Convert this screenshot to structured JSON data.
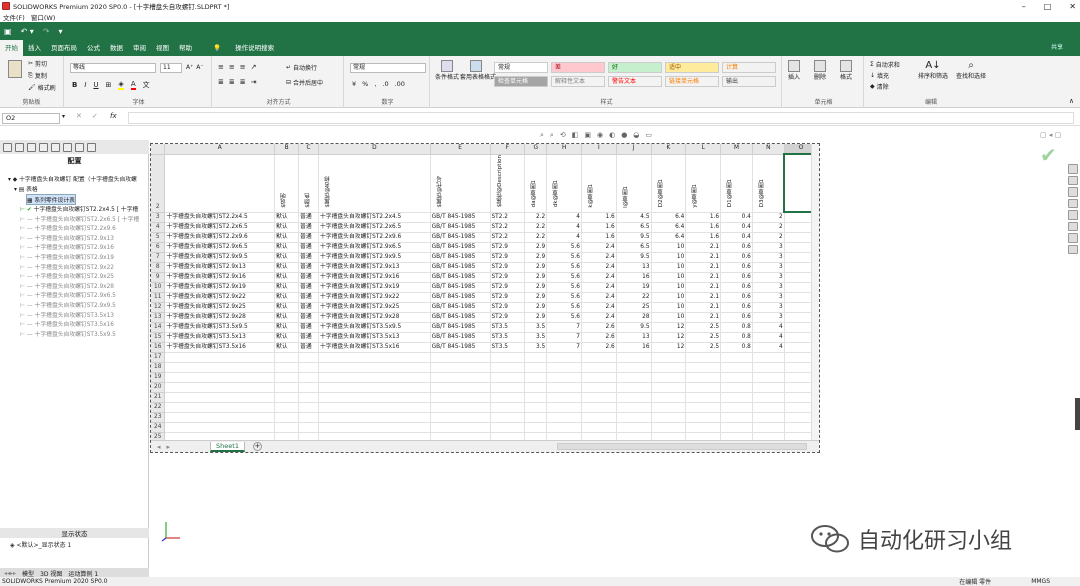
{
  "titlebar": {
    "title": "SOLIDWORKS Premium 2020 SP0.0 - [十字槽盘头自攻螺钉.SLDPRT *]"
  },
  "menubar": {
    "items": [
      "文件(F)",
      "窗口(W)"
    ]
  },
  "ribbon_tabs": {
    "tabs": [
      "开始",
      "插入",
      "页面布局",
      "公式",
      "数据",
      "审阅",
      "视图",
      "帮助"
    ],
    "search": "操作说明搜索",
    "share": "共享"
  },
  "ribbon": {
    "clipboard": {
      "cut": "剪切",
      "copy": "复制",
      "painter": "格式刷",
      "label": "剪贴板"
    },
    "font": {
      "name": "等线",
      "size": "11",
      "label": "字体"
    },
    "align": {
      "wrap": "自动换行",
      "merge": "合并后居中",
      "label": "对齐方式"
    },
    "number": {
      "format": "常规",
      "label": "数字"
    },
    "styles": {
      "cond": "条件格式",
      "table": "套用表格格式",
      "label": "样式",
      "cells": [
        {
          "t": "常规",
          "bg": "#ffffff",
          "fg": "#222"
        },
        {
          "t": "差",
          "bg": "#ffc7ce",
          "fg": "#9c0006"
        },
        {
          "t": "好",
          "bg": "#c6efce",
          "fg": "#006100"
        },
        {
          "t": "适中",
          "bg": "#ffeb9c",
          "fg": "#9c5700"
        },
        {
          "t": "计算",
          "bg": "#f2f2f2",
          "fg": "#fa7d00"
        },
        {
          "t": "检查单元格",
          "bg": "#a5a5a5",
          "fg": "#fff"
        },
        {
          "t": "解释性文本",
          "bg": "#f3f3f3",
          "fg": "#7f7f7f"
        },
        {
          "t": "警告文本",
          "bg": "#f3f3f3",
          "fg": "#ff0000"
        },
        {
          "t": "链接单元格",
          "bg": "#f3f3f3",
          "fg": "#fa7d00"
        },
        {
          "t": "输出",
          "bg": "#f2f2f2",
          "fg": "#3f3f3f"
        }
      ]
    },
    "cellsgrp": {
      "insert": "插入",
      "delete": "删除",
      "format": "格式",
      "label": "单元格"
    },
    "edit": {
      "autosum": "自动求和",
      "fill": "填充",
      "clear": "清除",
      "sort": "排序和筛选",
      "find": "查找和选择",
      "label": "编辑"
    }
  },
  "formula": {
    "namebox": "O2",
    "fx": "fx"
  },
  "leftpanel": {
    "title": "配置",
    "tree": [
      "十字槽盘头自攻螺钉 配置（十字槽盘头自攻螺",
      "表格",
      "系列零件设计表",
      "十字槽盘头自攻螺钉ST2.2x4.5 [ 十字槽",
      "十字槽盘头自攻螺钉ST2.2x6.5 [ 十字槽",
      "十字槽盘头自攻螺钉ST2.2x9.6",
      "十字槽盘头自攻螺钉ST2.9x13",
      "十字槽盘头自攻螺钉ST2.9x16",
      "十字槽盘头自攻螺钉ST2.9x19",
      "十字槽盘头自攻螺钉ST2.9x22",
      "十字槽盘头自攻螺钉ST2.9x25",
      "十字槽盘头自攻螺钉ST2.9x28",
      "十字槽盘头自攻螺钉ST2.9x6.5",
      "十字槽盘头自攻螺钉ST2.9x9.5",
      "十字槽盘头自攻螺钉ST3.5x13",
      "十字槽盘头自攻螺钉ST3.5x16",
      "十字槽盘头自攻螺钉ST3.5x9.5"
    ],
    "display_state_title": "显示状态",
    "display_state": "<默认>_显示状态 1",
    "bottom_tabs": [
      "模型",
      "3D 视图",
      "运动算例 1"
    ]
  },
  "sheet": {
    "cols": [
      "A",
      "B",
      "C",
      "D",
      "E",
      "F",
      "G",
      "H",
      "I",
      "J",
      "K",
      "L",
      "M",
      "N",
      "O"
    ],
    "headers": [
      "",
      "$说明",
      "$颜色",
      "$属性@名称",
      "$属性@代号",
      "$属性@Description",
      "da@草图1",
      "dk@草图1",
      "k@草图1",
      "l@草图1",
      "D2@草图1",
      "y@草图1",
      "D1@草图1",
      "D3@草图1",
      ""
    ],
    "rows": [
      [
        "十字槽盘头自攻螺钉ST2.2x4.5",
        "默认",
        "普通",
        "十字槽盘头自攻螺钉ST2.2x4.5",
        "GB/T 845-1985",
        "ST2.2",
        "2.2",
        "4",
        "1.6",
        "4.5",
        "6.4",
        "1.6",
        "0.4",
        "2"
      ],
      [
        "十字槽盘头自攻螺钉ST2.2x6.5",
        "默认",
        "普通",
        "十字槽盘头自攻螺钉ST2.2x6.5",
        "GB/T 845-1985",
        "ST2.2",
        "2.2",
        "4",
        "1.6",
        "6.5",
        "6.4",
        "1.6",
        "0.4",
        "2"
      ],
      [
        "十字槽盘头自攻螺钉ST2.2x9.6",
        "默认",
        "普通",
        "十字槽盘头自攻螺钉ST2.2x9.6",
        "GB/T 845-1985",
        "ST2.2",
        "2.2",
        "4",
        "1.6",
        "9.5",
        "6.4",
        "1.6",
        "0.4",
        "2"
      ],
      [
        "十字槽盘头自攻螺钉ST2.9x6.5",
        "默认",
        "普通",
        "十字槽盘头自攻螺钉ST2.9x6.5",
        "GB/T 845-1985",
        "ST2.9",
        "2.9",
        "5.6",
        "2.4",
        "6.5",
        "10",
        "2.1",
        "0.6",
        "3"
      ],
      [
        "十字槽盘头自攻螺钉ST2.9x9.5",
        "默认",
        "普通",
        "十字槽盘头自攻螺钉ST2.9x9.5",
        "GB/T 845-1985",
        "ST2.9",
        "2.9",
        "5.6",
        "2.4",
        "9.5",
        "10",
        "2.1",
        "0.6",
        "3"
      ],
      [
        "十字槽盘头自攻螺钉ST2.9x13",
        "默认",
        "普通",
        "十字槽盘头自攻螺钉ST2.9x13",
        "GB/T 845-1985",
        "ST2.9",
        "2.9",
        "5.6",
        "2.4",
        "13",
        "10",
        "2.1",
        "0.6",
        "3"
      ],
      [
        "十字槽盘头自攻螺钉ST2.9x16",
        "默认",
        "普通",
        "十字槽盘头自攻螺钉ST2.9x16",
        "GB/T 845-1985",
        "ST2.9",
        "2.9",
        "5.6",
        "2.4",
        "16",
        "10",
        "2.1",
        "0.6",
        "3"
      ],
      [
        "十字槽盘头自攻螺钉ST2.9x19",
        "默认",
        "普通",
        "十字槽盘头自攻螺钉ST2.9x19",
        "GB/T 845-1985",
        "ST2.9",
        "2.9",
        "5.6",
        "2.4",
        "19",
        "10",
        "2.1",
        "0.6",
        "3"
      ],
      [
        "十字槽盘头自攻螺钉ST2.9x22",
        "默认",
        "普通",
        "十字槽盘头自攻螺钉ST2.9x22",
        "GB/T 845-1985",
        "ST2.9",
        "2.9",
        "5.6",
        "2.4",
        "22",
        "10",
        "2.1",
        "0.6",
        "3"
      ],
      [
        "十字槽盘头自攻螺钉ST2.9x25",
        "默认",
        "普通",
        "十字槽盘头自攻螺钉ST2.9x25",
        "GB/T 845-1985",
        "ST2.9",
        "2.9",
        "5.6",
        "2.4",
        "25",
        "10",
        "2.1",
        "0.6",
        "3"
      ],
      [
        "十字槽盘头自攻螺钉ST2.9x28",
        "默认",
        "普通",
        "十字槽盘头自攻螺钉ST2.9x28",
        "GB/T 845-1985",
        "ST2.9",
        "2.9",
        "5.6",
        "2.4",
        "28",
        "10",
        "2.1",
        "0.6",
        "3"
      ],
      [
        "十字槽盘头自攻螺钉ST3.5x9.5",
        "默认",
        "普通",
        "十字槽盘头自攻螺钉ST3.5x9.5",
        "GB/T 845-1985",
        "ST3.5",
        "3.5",
        "7",
        "2.6",
        "9.5",
        "12",
        "2.5",
        "0.8",
        "4"
      ],
      [
        "十字槽盘头自攻螺钉ST3.5x13",
        "默认",
        "普通",
        "十字槽盘头自攻螺钉ST3.5x13",
        "GB/T 845-1985",
        "ST3.5",
        "3.5",
        "7",
        "2.6",
        "13",
        "12",
        "2.5",
        "0.8",
        "4"
      ],
      [
        "十字槽盘头自攻螺钉ST3.5x16",
        "默认",
        "普通",
        "十字槽盘头自攻螺钉ST3.5x16",
        "GB/T 845-1985",
        "ST3.5",
        "3.5",
        "7",
        "2.6",
        "16",
        "12",
        "2.5",
        "0.8",
        "4"
      ]
    ],
    "empty_rows": [
      17,
      18,
      19,
      20,
      21,
      22,
      23,
      24,
      25
    ],
    "tab": "Sheet1"
  },
  "status": {
    "left": "SOLIDWORKS Premium 2020 SP0.0",
    "edit": "在编辑 零件",
    "unit": "MMGS"
  },
  "watermark": {
    "text": "自动化研习小组"
  }
}
